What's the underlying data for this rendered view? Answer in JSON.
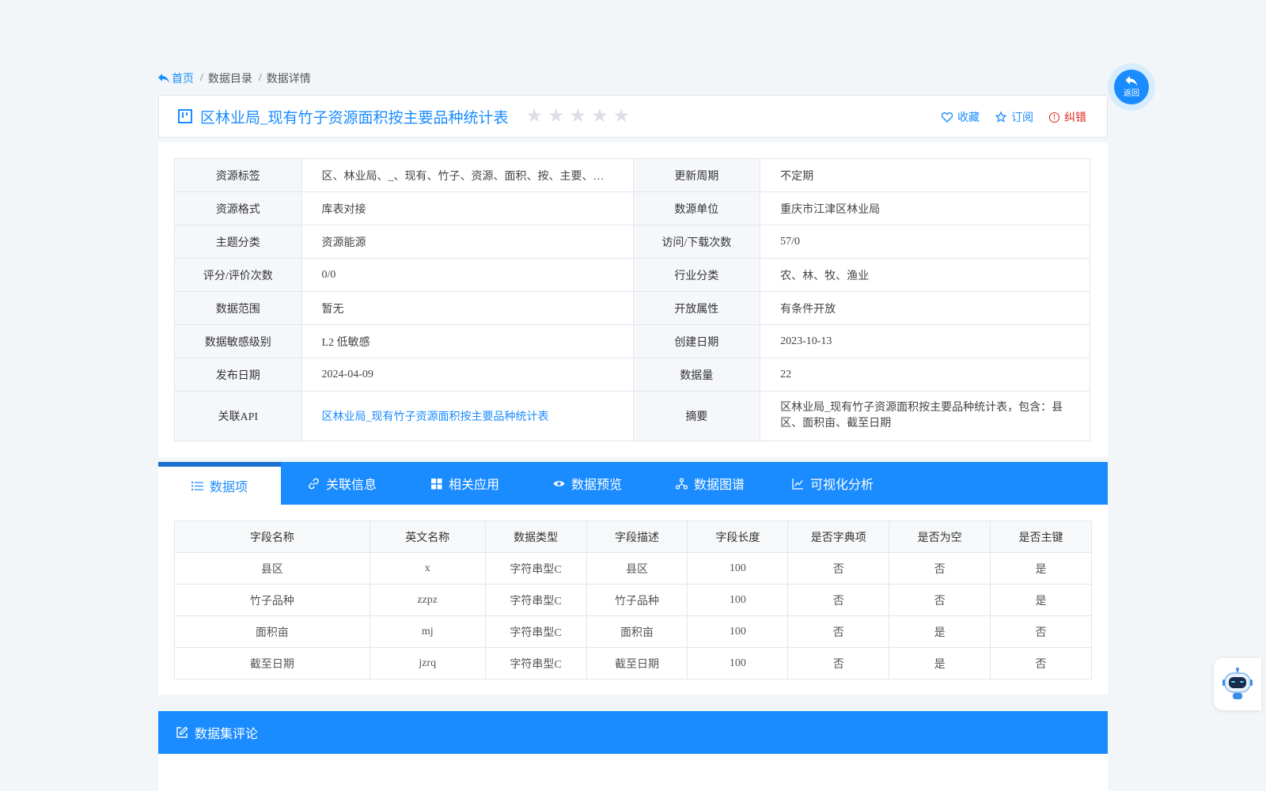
{
  "breadcrumb": {
    "home": "首页",
    "items": [
      "数据目录",
      "数据详情"
    ]
  },
  "back_button": {
    "label": "返回"
  },
  "title": {
    "text": "区林业局_现有竹子资源面积按主要品种统计表",
    "rating_stars": 0,
    "max_stars": 5,
    "actions": {
      "favorite": "收藏",
      "subscribe": "订阅",
      "report": "纠错"
    }
  },
  "info": [
    [
      "资源标签",
      "区、林业局、_、现有、竹子、资源、面积、按、主要、品种、统计表",
      "更新周期",
      "不定期"
    ],
    [
      "资源格式",
      "库表对接",
      "数源单位",
      "重庆市江津区林业局"
    ],
    [
      "主题分类",
      "资源能源",
      "访问/下载次数",
      "57/0"
    ],
    [
      "评分/评价次数",
      "0/0",
      "行业分类",
      "农、林、牧、渔业"
    ],
    [
      "数据范围",
      "暂无",
      "开放属性",
      "有条件开放"
    ],
    [
      "数据敏感级别",
      "L2 低敏感",
      "创建日期",
      "2023-10-13"
    ],
    [
      "发布日期",
      "2024-04-09",
      "数据量",
      "22"
    ],
    [
      "关联API",
      "区林业局_现有竹子资源面积按主要品种统计表",
      "摘要",
      "区林业局_现有竹子资源面积按主要品种统计表，包含：县区、面积亩、截至日期"
    ]
  ],
  "tabs": [
    "数据项",
    "关联信息",
    "相关应用",
    "数据预览",
    "数据图谱",
    "可视化分析"
  ],
  "fields_table": {
    "headers": [
      "字段名称",
      "英文名称",
      "数据类型",
      "字段描述",
      "字段长度",
      "是否字典项",
      "是否为空",
      "是否主键"
    ],
    "rows": [
      [
        "县区",
        "x",
        "字符串型C",
        "县区",
        "100",
        "否",
        "否",
        "是"
      ],
      [
        "竹子品种",
        "zzpz",
        "字符串型C",
        "竹子品种",
        "100",
        "否",
        "否",
        "是"
      ],
      [
        "面积亩",
        "mj",
        "字符串型C",
        "面积亩",
        "100",
        "否",
        "是",
        "否"
      ],
      [
        "截至日期",
        "jzrq",
        "字符串型C",
        "截至日期",
        "100",
        "否",
        "是",
        "否"
      ]
    ]
  },
  "comments": {
    "title": "数据集评论"
  },
  "colors": {
    "accent": "#1a8cff",
    "error": "#e0281e"
  },
  "icons": [
    "reply-icon",
    "grid-icon",
    "star-icon",
    "heart-icon",
    "alert-icon",
    "list-icon",
    "link-icon",
    "apps-icon",
    "eye-icon",
    "graph-icon",
    "chart-icon",
    "edit-icon",
    "robot-icon"
  ]
}
